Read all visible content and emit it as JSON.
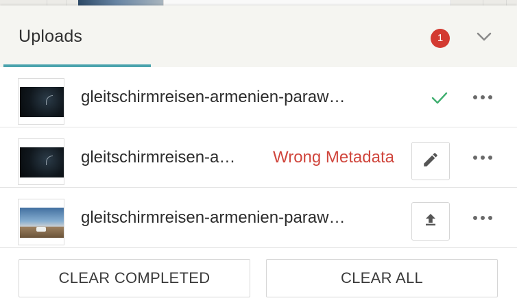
{
  "header": {
    "title": "Uploads",
    "badge_count": "1"
  },
  "uploads": [
    {
      "filename": "gleitschirmreisen-armenien-paraw…",
      "status": "completed",
      "status_icon": "check-icon",
      "thumbnail": "dark-night-sky"
    },
    {
      "filename": "gleitschirmreisen-a…",
      "status": "error",
      "status_text": "Wrong Metadata",
      "action_icon": "pencil-icon",
      "thumbnail": "dark-night-sky"
    },
    {
      "filename": "gleitschirmreisen-armenien-paraw…",
      "status": "pending",
      "action_icon": "upload-icon",
      "thumbnail": "sky-landscape-with-van"
    }
  ],
  "footer": {
    "clear_completed_label": "CLEAR COMPLETED",
    "clear_all_label": "CLEAR ALL"
  },
  "colors": {
    "accent": "#4aa3ad",
    "badge": "#d33a31",
    "error": "#d0463d",
    "success": "#3fae6f",
    "header_bg": "#f5f5f1"
  }
}
